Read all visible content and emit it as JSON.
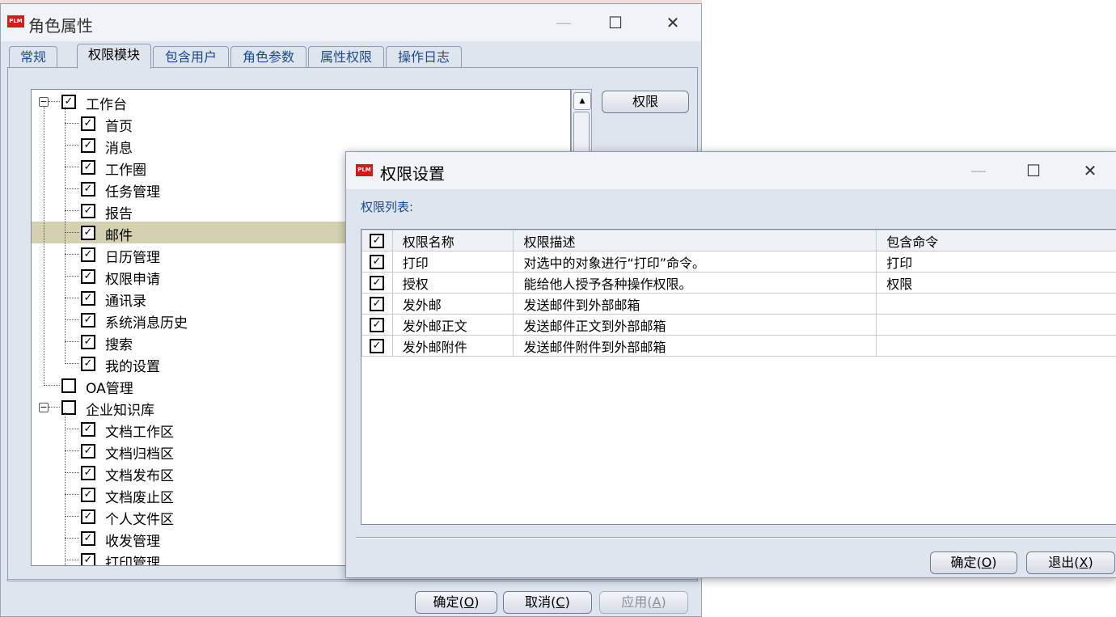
{
  "main_window": {
    "title": "角色属性",
    "logo_text": "PLM",
    "tabs": [
      "常规",
      "权限模块",
      "包含用户",
      "角色参数",
      "属性权限",
      "操作日志"
    ],
    "active_tab": "权限模块",
    "permission_button": "权限",
    "tree": [
      {
        "label": "工作台",
        "checked": true,
        "level": 0,
        "expander": "⊟"
      },
      {
        "label": "首页",
        "checked": true,
        "level": 1
      },
      {
        "label": "消息",
        "checked": true,
        "level": 1
      },
      {
        "label": "工作圈",
        "checked": true,
        "level": 1
      },
      {
        "label": "任务管理",
        "checked": true,
        "level": 1
      },
      {
        "label": "报告",
        "checked": true,
        "level": 1
      },
      {
        "label": "邮件",
        "checked": true,
        "level": 1,
        "selected": true
      },
      {
        "label": "日历管理",
        "checked": true,
        "level": 1
      },
      {
        "label": "权限申请",
        "checked": true,
        "level": 1
      },
      {
        "label": "通讯录",
        "checked": true,
        "level": 1
      },
      {
        "label": "系统消息历史",
        "checked": true,
        "level": 1
      },
      {
        "label": "搜索",
        "checked": true,
        "level": 1
      },
      {
        "label": "我的设置",
        "checked": true,
        "level": 1
      },
      {
        "label": "OA管理",
        "checked": false,
        "level": 0
      },
      {
        "label": "企业知识库",
        "checked": false,
        "level": 0,
        "expander": "⊟"
      },
      {
        "label": "文档工作区",
        "checked": true,
        "level": 1
      },
      {
        "label": "文档归档区",
        "checked": true,
        "level": 1
      },
      {
        "label": "文档发布区",
        "checked": true,
        "level": 1
      },
      {
        "label": "文档废止区",
        "checked": true,
        "level": 1
      },
      {
        "label": "个人文件区",
        "checked": true,
        "level": 1
      },
      {
        "label": "收发管理",
        "checked": true,
        "level": 1
      },
      {
        "label": "打印管理",
        "checked": true,
        "level": 1
      }
    ],
    "buttons": {
      "ok": {
        "text": "确定",
        "key": "O"
      },
      "cancel": {
        "text": "取消",
        "key": "C"
      },
      "apply": {
        "text": "应用",
        "key": "A"
      }
    }
  },
  "dialog": {
    "title": "权限设置",
    "logo_text": "PLM",
    "list_label": "权限列表:",
    "columns": [
      "权限名称",
      "权限描述",
      "包含命令"
    ],
    "rows": [
      {
        "checked": true,
        "name": "打印",
        "desc": "对选中的对象进行“打印”命令。",
        "cmd": "打印"
      },
      {
        "checked": true,
        "name": "授权",
        "desc": "能给他人授予各种操作权限。",
        "cmd": "权限"
      },
      {
        "checked": true,
        "name": "发外邮",
        "desc": "发送邮件到外部邮箱",
        "cmd": ""
      },
      {
        "checked": true,
        "name": "发外邮正文",
        "desc": "发送邮件正文到外部邮箱",
        "cmd": ""
      },
      {
        "checked": true,
        "name": "发外邮附件",
        "desc": "发送邮件附件到外部邮箱",
        "cmd": ""
      }
    ],
    "buttons": {
      "ok": {
        "text": "确定",
        "key": "O"
      },
      "exit": {
        "text": "退出",
        "key": "X"
      }
    }
  },
  "icons": {
    "check": "☑",
    "minimize": "—",
    "maximize": "☐",
    "close": "✕",
    "scroll_up": "▲",
    "expander": "⊟"
  },
  "colors": {
    "logo_red": "#d61a1a",
    "tab_text": "#1b4b8c",
    "selection": "#d4d1b0",
    "window_bg": "#dfe5ee"
  }
}
